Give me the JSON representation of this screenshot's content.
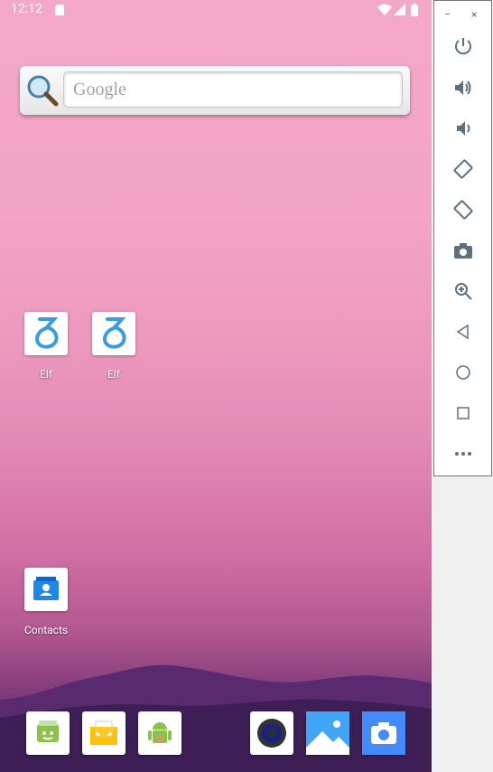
{
  "status_bar": {
    "time": "12:12"
  },
  "search": {
    "placeholder": "Google"
  },
  "apps": [
    {
      "label": "Elf"
    },
    {
      "label": "Elf"
    },
    {
      "label": "Contacts"
    }
  ],
  "emulator_controls": {
    "minimize": "−",
    "close": "×"
  }
}
